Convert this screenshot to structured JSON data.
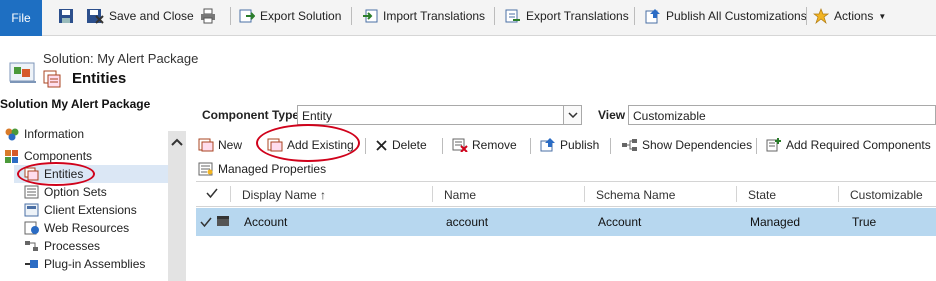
{
  "ribbon": {
    "file": "File",
    "save_close": "Save and Close",
    "export_solution": "Export Solution",
    "import_translations": "Import Translations",
    "export_translations": "Export Translations",
    "publish_all": "Publish All Customizations",
    "actions": "Actions"
  },
  "header": {
    "solution_label": "Solution: My Alert Package",
    "page_title": "Entities"
  },
  "nav": {
    "title": "Solution My Alert Package",
    "items": [
      {
        "label": "Information",
        "icon": "information-icon"
      },
      {
        "label": "Components",
        "icon": "components-icon"
      },
      {
        "label": "Entities",
        "icon": "entities-icon"
      },
      {
        "label": "Option Sets",
        "icon": "option-sets-icon"
      },
      {
        "label": "Client Extensions",
        "icon": "client-extensions-icon"
      },
      {
        "label": "Web Resources",
        "icon": "web-resources-icon"
      },
      {
        "label": "Processes",
        "icon": "processes-icon"
      },
      {
        "label": "Plug-in Assemblies",
        "icon": "plugin-assemblies-icon"
      }
    ]
  },
  "filter": {
    "component_type_label": "Component Type",
    "component_type_value": "Entity",
    "view_label": "View",
    "view_value": "Customizable"
  },
  "toolbar": {
    "new": "New",
    "add_existing": "Add Existing",
    "delete": "Delete",
    "remove": "Remove",
    "publish": "Publish",
    "show_dependencies": "Show Dependencies",
    "add_required": "Add Required Components",
    "managed_properties": "Managed Properties"
  },
  "grid": {
    "columns": [
      "Display Name ↑",
      "Name",
      "Schema Name",
      "State",
      "Customizable"
    ],
    "rows": [
      {
        "display_name": "Account",
        "name": "account",
        "schema_name": "Account",
        "state": "Managed",
        "customizable": "True"
      }
    ]
  },
  "colors": {
    "file_button": "#1e6fc2",
    "selected_row": "#b7d7ef",
    "annotation": "#d0021b"
  }
}
